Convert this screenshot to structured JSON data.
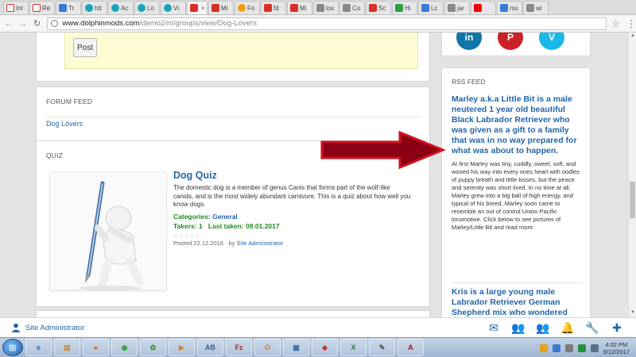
{
  "browser": {
    "tabs": [
      {
        "label": "Int",
        "fav": "gmail"
      },
      {
        "label": "Re",
        "fav": "gmail"
      },
      {
        "label": "Tr",
        "fav": "blue"
      },
      {
        "label": "htt",
        "fav": "teal"
      },
      {
        "label": "Ac",
        "fav": "teal"
      },
      {
        "label": "Lo",
        "fav": "teal"
      },
      {
        "label": "Vi",
        "fav": "teal"
      },
      {
        "label": "",
        "fav": "red",
        "active": true
      },
      {
        "label": "Mi",
        "fav": "red"
      },
      {
        "label": "Fo",
        "fav": "orange"
      },
      {
        "label": "fd",
        "fav": "red"
      },
      {
        "label": "Mi",
        "fav": "red"
      },
      {
        "label": "lox",
        "fav": "gray"
      },
      {
        "label": "Co",
        "fav": "gray"
      },
      {
        "label": "Sc",
        "fav": "red"
      },
      {
        "label": "Hi",
        "fav": "green"
      },
      {
        "label": "Lc",
        "fav": "blue"
      },
      {
        "label": "jar",
        "fav": "gray"
      },
      {
        "label": "",
        "fav": "yt"
      },
      {
        "label": "rss",
        "fav": "blue"
      },
      {
        "label": "wi",
        "fav": "gray"
      }
    ],
    "url_host": "www.dolphinmods.com",
    "url_path": "/demo2/m/groups/view/Dog-Lovers"
  },
  "post_card": {
    "post_button": "Post"
  },
  "forum_feed": {
    "title": "FORUM FEED",
    "link": "Dog Lovers"
  },
  "quiz": {
    "title": "QUIZ",
    "quiz_title": "Dog Quiz",
    "description": "The domestic dog is a member of genus Canis that forms part of the wolf-like canids, and is the most widely abundant carnivore. This is a quiz about how well you know dogs.",
    "categories_label": "Categories:",
    "categories_value": "General",
    "takers_label": "Takers:",
    "takers_value": "1",
    "last_taken_label": "Last taken:",
    "last_taken_value": "09.01.2017",
    "posted_text": "Posted 22.12.2016 · by",
    "author": "Site Administrator",
    "stars": "☆☆☆☆☆"
  },
  "rss": {
    "title": "RSS FEED",
    "item1_title": "Marley a.k.a Little Bit is a male neutered 1 year old beautiful Black Labrador Retriever who was given as a gift to a family that was in no way prepared for what was about to happen.",
    "item1_body": "At first Marley was tiny, cuddly, sweet, soft, and wooed his way into every ones heart with oodles of puppy breath and little kisses, but the peace and serenity was short lived. In no time at all, Marley grew into a big ball of high energy, and typical of his breed, Marley soon came to resemble an out of control Union Pacific locomotive. Click below to see pictures of Marley/Little Bit and read more.",
    "item2_title": "Kris is a large young male Labrador Retriever German Shepherd mix who wondered right through the front door of a hospital in Arkadelphia Arkansas on Christmas day looking for some Christmas Cheer."
  },
  "social": {
    "linkedin": "in",
    "pinterest": "P",
    "vimeo": "V"
  },
  "bottombar": {
    "user": "Site Administrator",
    "icons": [
      "envelope-icon",
      "friends-icon",
      "groups-icon",
      "bell-icon",
      "wrench-icon",
      "plus-icon"
    ]
  },
  "taskbar": {
    "time": "4:02 PM",
    "date": "9/12/2017",
    "apps": [
      {
        "label": "e",
        "color": "#1f74c6"
      },
      {
        "label": "▤",
        "color": "#c98a2a"
      },
      {
        "label": "●",
        "color": "#e0642b"
      },
      {
        "label": "◉",
        "color": "#2e9d46"
      },
      {
        "label": "✿",
        "color": "#3b8a2a"
      },
      {
        "label": "▶",
        "color": "#e07b1a"
      },
      {
        "label": "AB",
        "color": "#2b5f9e"
      },
      {
        "label": "Fz",
        "color": "#b8261e"
      },
      {
        "label": "O",
        "color": "#d47a12"
      },
      {
        "label": "▦",
        "color": "#3a6ea5"
      },
      {
        "label": "◆",
        "color": "#c0392b"
      },
      {
        "label": "X",
        "color": "#1e7b3a"
      },
      {
        "label": "✎",
        "color": "#555"
      },
      {
        "label": "A",
        "color": "#b00"
      }
    ]
  },
  "colors": {
    "link": "#2366a8",
    "green": "#1f8a1f",
    "arrow": "#8b0012"
  }
}
